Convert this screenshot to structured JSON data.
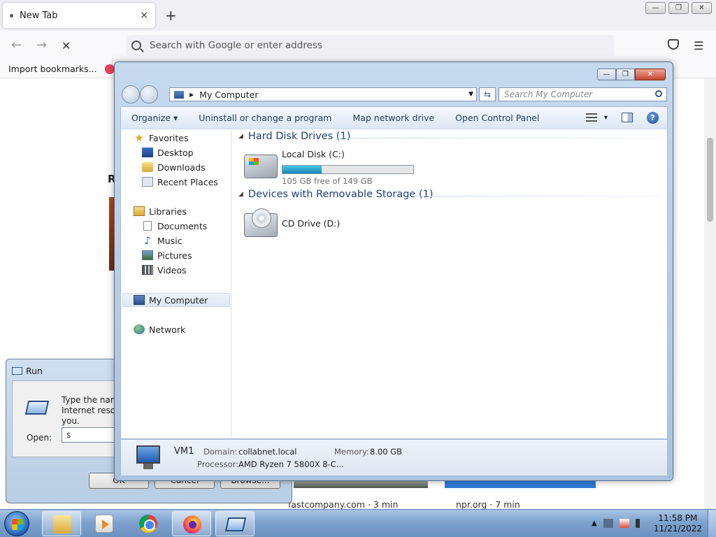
{
  "firefox": {
    "tab_title": "New Tab",
    "tab_close": "×",
    "new_tab": "+",
    "url_placeholder": "Search with Google or enter address",
    "bookmark_import": "Import bookmarks...",
    "back": "←",
    "forward": "→",
    "stop": "✕",
    "menu": "☰",
    "behind_letter": "R",
    "sources": [
      {
        "text": "fastcompany.com · 3 min"
      },
      {
        "text": "npr.org · 7 min"
      }
    ],
    "window_controls": {
      "min": "—",
      "max": "❐",
      "close": "✕"
    }
  },
  "run_dialog": {
    "title": "Run",
    "description": "Type the name of a program, folder, document, or Internet resource, and Windows will open it for you.",
    "open_label": "Open:",
    "open_value": "s",
    "ok": "OK",
    "cancel": "Cancel",
    "browse": "Browse..."
  },
  "explorer": {
    "window_controls": {
      "min": "—",
      "max": "❐",
      "close": "✕"
    },
    "address": "My Computer",
    "search_placeholder": "Search My Computer",
    "refresh": "⇆",
    "toolbar": {
      "organize": "Organize ▾",
      "uninstall": "Uninstall or change a program",
      "map_drive": "Map network drive",
      "control_panel": "Open Control Panel",
      "views_dropdown": "▾",
      "help": "?"
    },
    "nav": {
      "favorites": "Favorites",
      "desktop": "Desktop",
      "downloads": "Downloads",
      "recent": "Recent Places",
      "libraries": "Libraries",
      "documents": "Documents",
      "music": "Music",
      "pictures": "Pictures",
      "videos": "Videos",
      "computer": "My Computer",
      "network": "Network"
    },
    "groups": {
      "hdd": "Hard Disk Drives (1)",
      "removable": "Devices with Removable Storage (1)"
    },
    "drives": {
      "c_name": "Local Disk (C:)",
      "c_free": "105 GB free of 149 GB",
      "c_used_fraction": 0.3,
      "d_name": "CD Drive (D:)"
    },
    "details": {
      "name": "VM1",
      "domain_label": "Domain:",
      "domain": "collabnet.local",
      "memory_label": "Memory:",
      "memory": "8.00 GB",
      "processor_label": "Processor:",
      "processor": "AMD Ryzen 7 5800X 8-C..."
    }
  },
  "taskbar": {
    "time": "11:58 PM",
    "date": "11/21/2022",
    "tray_expand": "▲"
  }
}
